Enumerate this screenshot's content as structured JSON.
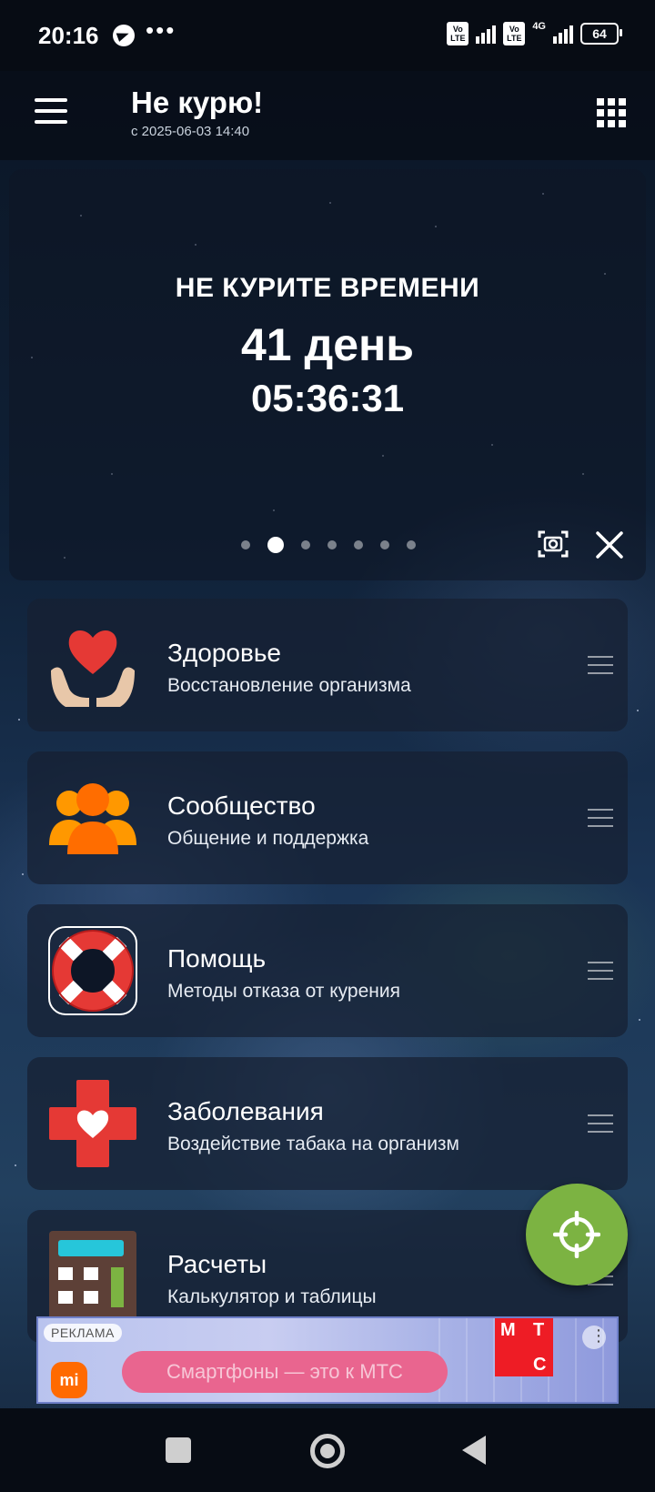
{
  "status_bar": {
    "time": "20:16",
    "battery": "64",
    "network": "4G",
    "volte_label_1": "Vo",
    "volte_label_2": "LTE"
  },
  "app_bar": {
    "title": "Не курю!",
    "subtitle": "с 2025-06-03 14:40",
    "menu_icon": "hamburger-menu-icon",
    "apps_icon": "grid-apps-icon"
  },
  "hero": {
    "heading": "НЕ КУРИТЕ ВРЕМЕНИ",
    "days": "41 день",
    "time": "05:36:31",
    "pages_total": 7,
    "active_page": 2
  },
  "cards": [
    {
      "title": "Здоровье",
      "description": "Восстановление организма",
      "icon": "heart-in-hands-icon"
    },
    {
      "title": "Сообщество",
      "description": "Общение и поддержка",
      "icon": "community-people-icon"
    },
    {
      "title": "Помощь",
      "description": "Методы отказа от курения",
      "icon": "lifebuoy-icon"
    },
    {
      "title": "Заболевания",
      "description": "Воздействие табака на организм",
      "icon": "medical-cross-heart-icon"
    },
    {
      "title": "Расчеты",
      "description": "Калькулятор и таблицы",
      "icon": "calculator-icon"
    }
  ],
  "fab": {
    "icon": "crosshair-target-icon",
    "color": "#7cb342"
  },
  "ad": {
    "label": "РЕКЛАМА",
    "button_text": "Смартфоны — это к МТС",
    "brand_logo_text": "mi",
    "brand_letters": [
      "М",
      "Т",
      "С"
    ],
    "accent_color": "#ee1c25"
  },
  "colors": {
    "fab": "#7cb342",
    "card_background": "rgba(22,32,50,0.72)",
    "heart_red": "#e53935",
    "community_orange": "#ff7a00"
  }
}
